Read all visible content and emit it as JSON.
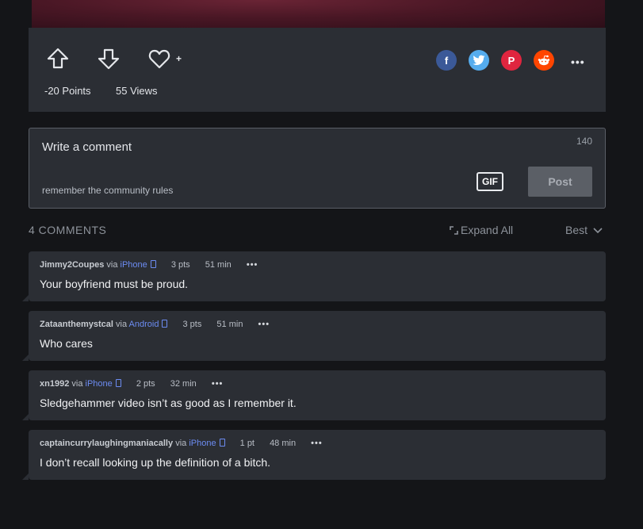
{
  "post": {
    "points": "-20 Points",
    "views": "55 Views",
    "favorite_plus": "+",
    "share": [
      {
        "name": "facebook",
        "icon": "facebook-icon",
        "color": "#3b5998",
        "glyph": "f"
      },
      {
        "name": "twitter",
        "icon": "twitter-icon",
        "color": "#55acee",
        "glyph": ""
      },
      {
        "name": "pinterest",
        "icon": "pinterest-icon",
        "color": "#e0253f",
        "glyph": "P"
      },
      {
        "name": "reddit",
        "icon": "reddit-icon",
        "color": "#ff4500",
        "glyph": ""
      }
    ],
    "more": "•••"
  },
  "comment_box": {
    "placeholder": "Write a comment",
    "char_count": "140",
    "rules_hint": "remember the community rules",
    "gif_label": "GIF",
    "post_label": "Post"
  },
  "comments_header": {
    "count_label": "4 COMMENTS",
    "expand_all": "Expand All",
    "sort": "Best"
  },
  "comments": [
    {
      "user": "Jimmy2Coupes",
      "via": "via",
      "platform": "iPhone",
      "points": "3 pts",
      "time": "51 min",
      "more": "•••",
      "text": "Your boyfriend must be proud."
    },
    {
      "user": "Zataanthemystcal",
      "via": "via",
      "platform": "Android",
      "points": "3 pts",
      "time": "51 min",
      "more": "•••",
      "text": "Who cares"
    },
    {
      "user": "xn1992",
      "via": "via",
      "platform": "iPhone",
      "points": "2 pts",
      "time": "32 min",
      "more": "•••",
      "text": "Sledgehammer video isn’t as good as I remember it."
    },
    {
      "user": "captaincurrylaughingmaniacally",
      "via": "via",
      "platform": "iPhone",
      "points": "1 pt",
      "time": "48 min",
      "more": "•••",
      "text": "I don’t recall looking up the definition of a bitch."
    }
  ]
}
